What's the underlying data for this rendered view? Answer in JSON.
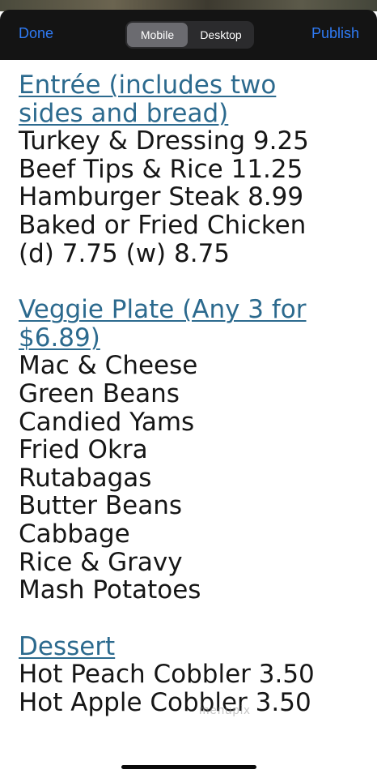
{
  "toolbar": {
    "done_label": "Done",
    "publish_label": "Publish",
    "view_modes": [
      "Mobile",
      "Desktop"
    ],
    "selected_view_mode": "Mobile",
    "accent_color": "#2f7bf5"
  },
  "menu": {
    "entree": {
      "heading_line1": "Entrée (includes two",
      "heading_line2": "sides and bread)",
      "items": [
        "Turkey & Dressing 9.25",
        "Beef Tips & Rice 11.25",
        "Hamburger Steak 8.99",
        "Baked or Fried Chicken",
        "(d) 7.75 (w) 8.75"
      ]
    },
    "veggie": {
      "heading_line1": "Veggie Plate (Any 3 for",
      "heading_line2": "$6.89)",
      "items": [
        "Mac & Cheese",
        "Green Beans",
        "Candied Yams",
        "Fried Okra",
        "Rutabagas",
        "Butter Beans",
        "Cabbage",
        "Rice & Gravy",
        "Mash Potatoes"
      ]
    },
    "dessert": {
      "heading": "Dessert",
      "items": [
        "Hot Peach Cobbler 3.50",
        "Hot Apple Cobbler 3.50"
      ]
    },
    "heading_color": "#2c6a8e"
  },
  "watermark_text": "menupix"
}
